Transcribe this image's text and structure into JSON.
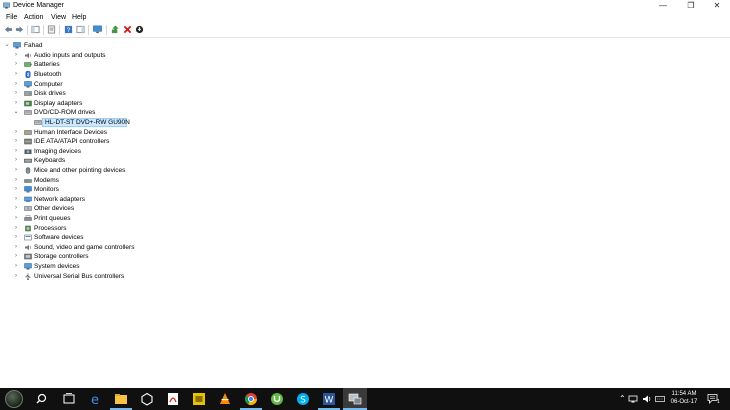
{
  "window": {
    "title": "Device Manager",
    "controls": {
      "minimize": "—",
      "maximize": "❐",
      "close": "✕"
    }
  },
  "menu": [
    "File",
    "Action",
    "View",
    "Help"
  ],
  "toolbar": [
    "back-icon",
    "forward-icon",
    "show-hide-console-tree-icon",
    "properties-icon",
    "help-icon",
    "action-pane-icon",
    "monitor-icon",
    "update-driver-icon",
    "uninstall-icon",
    "disable-device-icon"
  ],
  "tree": {
    "root": "Fahad",
    "categories": [
      {
        "label": "Audio inputs and outputs",
        "icon": "speaker-icon"
      },
      {
        "label": "Batteries",
        "icon": "battery-icon"
      },
      {
        "label": "Bluetooth",
        "icon": "bluetooth-icon"
      },
      {
        "label": "Computer",
        "icon": "computer-icon"
      },
      {
        "label": "Disk drives",
        "icon": "disk-drive-icon"
      },
      {
        "label": "Display adapters",
        "icon": "display-adapter-icon"
      },
      {
        "label": "DVD/CD-ROM drives",
        "icon": "dvd-drive-icon",
        "expanded": true,
        "children": [
          {
            "label": "HL-DT-ST DVD+-RW GU90N",
            "selected": true
          }
        ]
      },
      {
        "label": "Human Interface Devices",
        "icon": "hid-icon"
      },
      {
        "label": "IDE ATA/ATAPI controllers",
        "icon": "ide-controller-icon"
      },
      {
        "label": "Imaging devices",
        "icon": "camera-icon"
      },
      {
        "label": "Keyboards",
        "icon": "keyboard-icon"
      },
      {
        "label": "Mice and other pointing devices",
        "icon": "mouse-icon"
      },
      {
        "label": "Modems",
        "icon": "modem-icon"
      },
      {
        "label": "Monitors",
        "icon": "monitor-icon"
      },
      {
        "label": "Network adapters",
        "icon": "network-adapter-icon"
      },
      {
        "label": "Other devices",
        "icon": "other-devices-icon"
      },
      {
        "label": "Print queues",
        "icon": "printer-icon"
      },
      {
        "label": "Processors",
        "icon": "processor-icon"
      },
      {
        "label": "Software devices",
        "icon": "software-device-icon"
      },
      {
        "label": "Sound, video and game controllers",
        "icon": "sound-controller-icon"
      },
      {
        "label": "Storage controllers",
        "icon": "storage-controller-icon"
      },
      {
        "label": "System devices",
        "icon": "system-devices-icon"
      },
      {
        "label": "Universal Serial Bus controllers",
        "icon": "usb-icon"
      }
    ]
  },
  "taskbar": {
    "apps": [
      "search-icon",
      "task-view-icon",
      "edge-icon",
      "file-explorer-icon",
      "unity-icon",
      "adobe-reader-icon",
      "media-app-icon",
      "vlc-icon",
      "chrome-icon",
      "utorrent-icon",
      "skype-icon",
      "word-icon",
      "device-manager-icon"
    ],
    "clock": {
      "time": "11:54 AM",
      "date": "06-Oct-17"
    },
    "tray": [
      "show-hidden-icons-icon",
      "network-icon",
      "volume-icon",
      "keyboard-language-icon",
      "notifications-icon"
    ],
    "notification_count": "1"
  },
  "colors": {
    "selection": "#cce8ff",
    "taskbar": "#101010",
    "accent": "#76b9ed"
  }
}
